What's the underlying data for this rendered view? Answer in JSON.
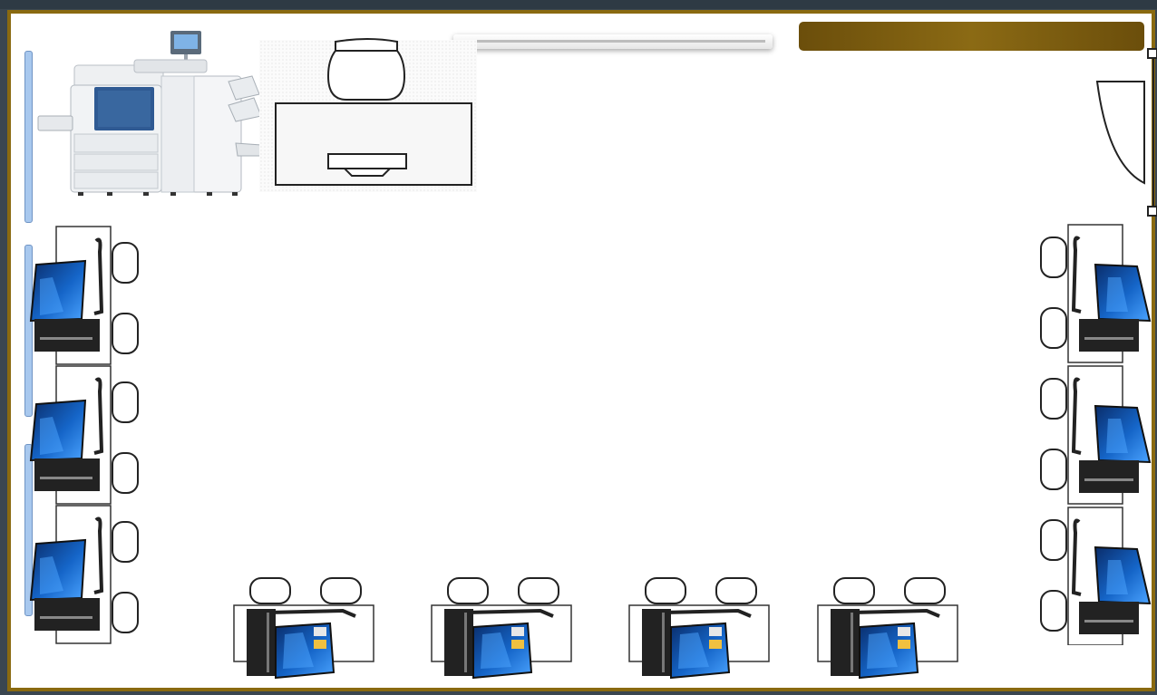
{
  "layout": {
    "title_plate": {
      "text": ""
    },
    "colors": {
      "background": "#3a4650",
      "frame_border": "#8a6a10",
      "plate": "#7a5c10",
      "wall_strip": "#a8c8ee",
      "monitor_screen": "#1565c8"
    },
    "icons": [
      "printer-icon",
      "teacher-desk-icon",
      "chair-icon",
      "door-icon",
      "computer-workstation-icon",
      "projector-screen-icon"
    ],
    "workstations": {
      "left_wall": 3,
      "right_wall": 3,
      "bottom_wall": 4
    }
  }
}
